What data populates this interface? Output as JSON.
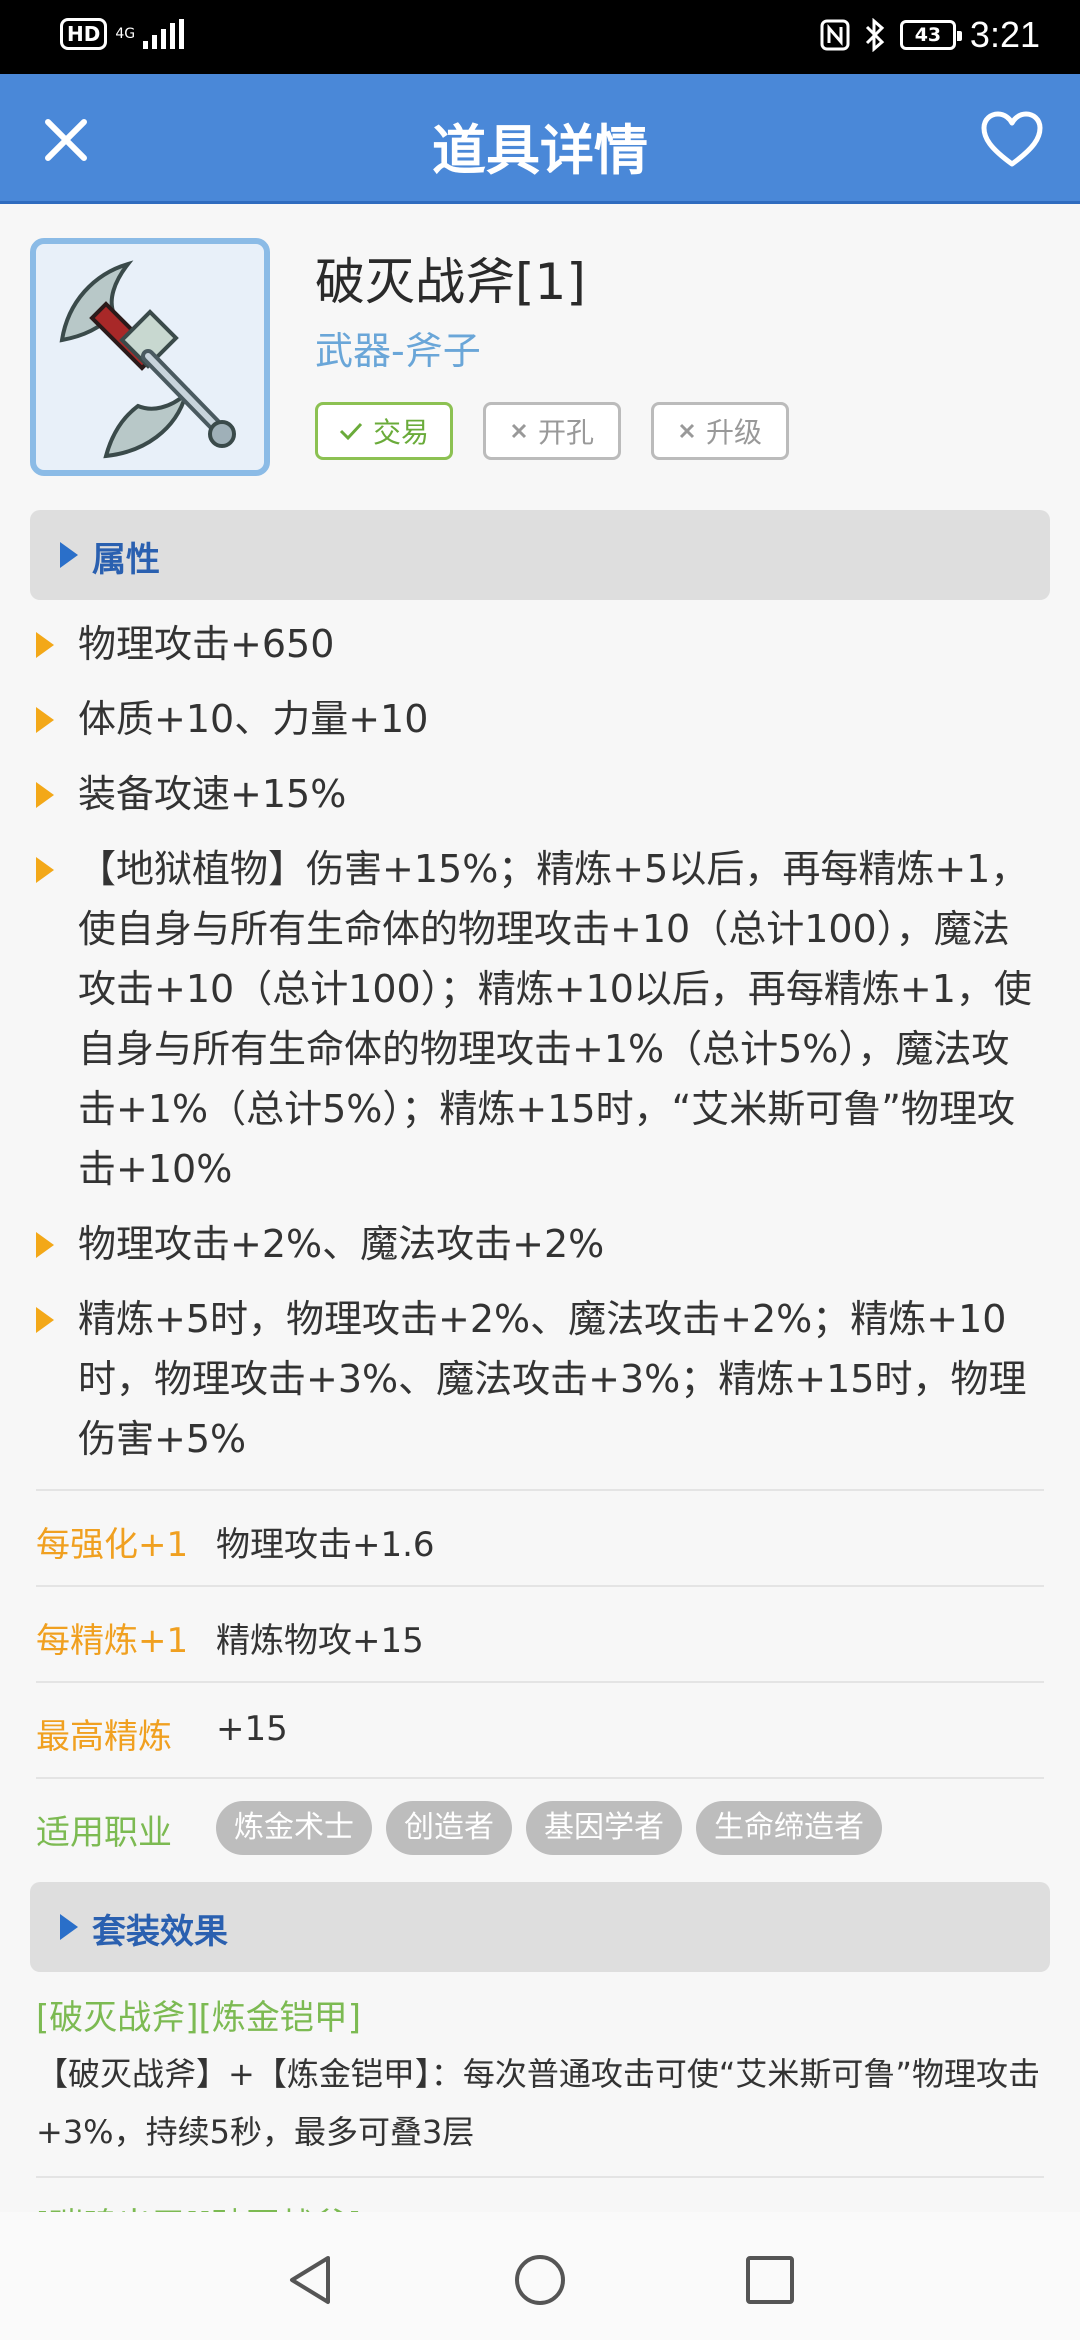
{
  "status_bar": {
    "hd": "HD",
    "network": "4G",
    "battery": "43",
    "time": "3:21",
    "icons": [
      "nfc-icon",
      "bluetooth-icon"
    ]
  },
  "app_bar": {
    "title": "道具详情",
    "icons": [
      "close-icon",
      "heart-icon"
    ]
  },
  "item": {
    "name": "破灭战斧[1]",
    "type": "武器-斧子",
    "tags": [
      {
        "label": "交易",
        "enabled": true
      },
      {
        "label": "开孔",
        "enabled": false
      },
      {
        "label": "升级",
        "enabled": false
      }
    ]
  },
  "attributes": {
    "header": "属性",
    "items": [
      "物理攻击+650",
      "体质+10、力量+10",
      "装备攻速+15%",
      "【地狱植物】伤害+15%；精炼+5以后，再每精炼+1，使自身与所有生命体的物理攻击+10（总计100），魔法攻击+10（总计100）；精炼+10以后，再每精炼+1，使自身与所有生命体的物理攻击+1%（总计5%），魔法攻击+1%（总计5%）；精炼+15时，“艾米斯可鲁”物理攻击+10%",
      "物理攻击+2%、魔法攻击+2%",
      "精炼+5时，物理攻击+2%、魔法攻击+2%；精炼+10时，物理攻击+3%、魔法攻击+3%；精炼+15时，物理伤害+5%"
    ]
  },
  "details": {
    "per_enhance_label": "每强化+1",
    "per_enhance_value": "物理攻击+1.6",
    "per_refine_label": "每精炼+1",
    "per_refine_value": "精炼物攻+15",
    "max_refine_label": "最高精炼",
    "max_refine_value": "+15",
    "jobs_label": "适用职业",
    "jobs": [
      "炼金术士",
      "创造者",
      "基因学者",
      "生命缔造者"
    ]
  },
  "set_effect": {
    "header": "套装效果",
    "sets": [
      {
        "name": "[破灭战斧][炼金铠甲]",
        "description": "【破灭战斧】+【炼金铠甲】：每次普通攻击可使“艾米斯可鲁”物理攻击+3%，持续5秒，最多可叠3层"
      },
      {
        "name": "[瑞鸣出甲][破灭战斧]",
        "description": ""
      }
    ]
  },
  "colors": {
    "app_bar": "#4a88d8",
    "accent_orange": "#f3a818",
    "accent_green": "#7cba52",
    "header_text": "#2a60b0"
  }
}
